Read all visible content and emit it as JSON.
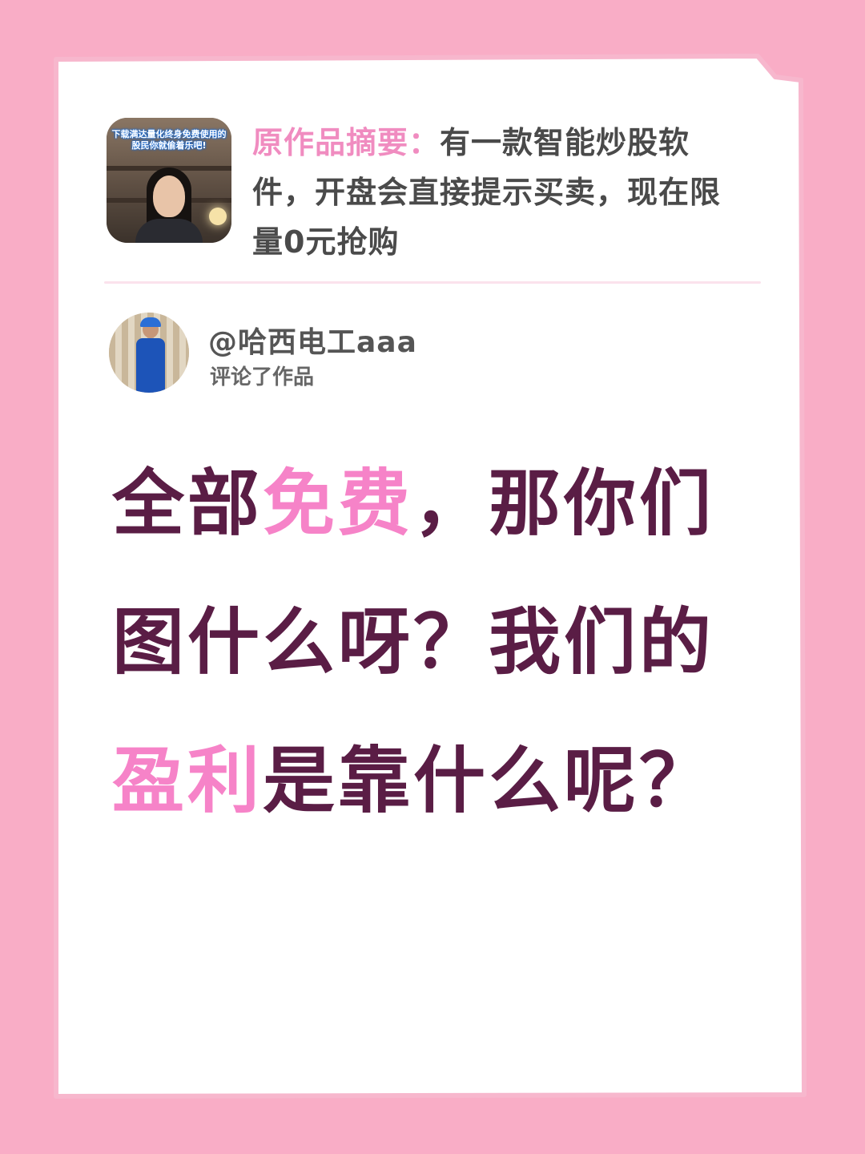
{
  "summary": {
    "label": "原作品摘要：",
    "text": "有一款智能炒股软件，开盘会直接提示买卖，现在限量0元抢购",
    "thumbnail_caption": "下载满达量化终身免费使用的股民你就偷着乐吧!"
  },
  "commenter": {
    "handle": "@哈西电工aaa",
    "action": "评论了作品"
  },
  "comment": {
    "segments": [
      {
        "text": "全部",
        "highlight": false
      },
      {
        "text": "免费",
        "highlight": true
      },
      {
        "text": "，那你们图什么呀？我们的",
        "highlight": false
      },
      {
        "text": "盈利",
        "highlight": true
      },
      {
        "text": "是靠什么呢？",
        "highlight": false
      }
    ]
  },
  "colors": {
    "background": "#f9adc6",
    "card": "#ffffff",
    "comment_text": "#5a1d45",
    "highlight": "#f683c8",
    "summary_label": "#f08cc0"
  }
}
